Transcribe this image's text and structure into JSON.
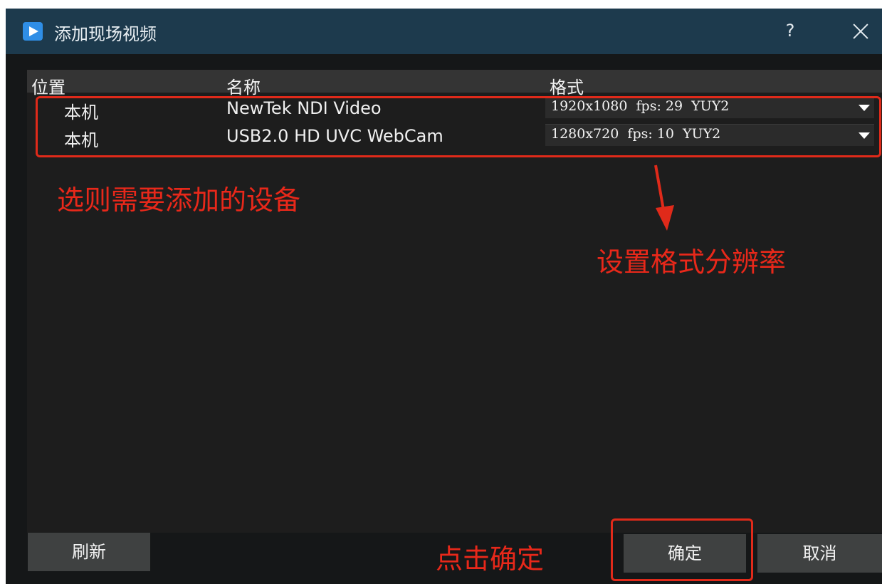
{
  "window": {
    "title": "添加现场视频",
    "help_label": "?"
  },
  "table": {
    "headers": {
      "location": "位置",
      "name": "名称",
      "format": "格式"
    },
    "rows": [
      {
        "location": "本机",
        "name": "NewTek NDI Video",
        "format": "1920x1080  fps: 29  YUY2"
      },
      {
        "location": "本机",
        "name": "USB2.0 HD UVC WebCam",
        "format": "1280x720  fps: 10  YUY2"
      }
    ]
  },
  "annotations": {
    "select_device": "选则需要添加的设备",
    "set_format": "设置格式分辨率",
    "click_ok": "点击确定",
    "color": "#e02a1a"
  },
  "buttons": {
    "refresh": "刷新",
    "ok": "确定",
    "cancel": "取消"
  },
  "icons": {
    "app": "play-icon",
    "close": "close-icon",
    "dropdown": "chevron-down-icon"
  },
  "colors": {
    "titlebar": "#1d3a4d",
    "window_bg": "#151718",
    "list_bg": "#1d1d1d",
    "header_bg": "#343434",
    "button_bg": "#3f4141",
    "app_icon": "#2f8ee6"
  }
}
